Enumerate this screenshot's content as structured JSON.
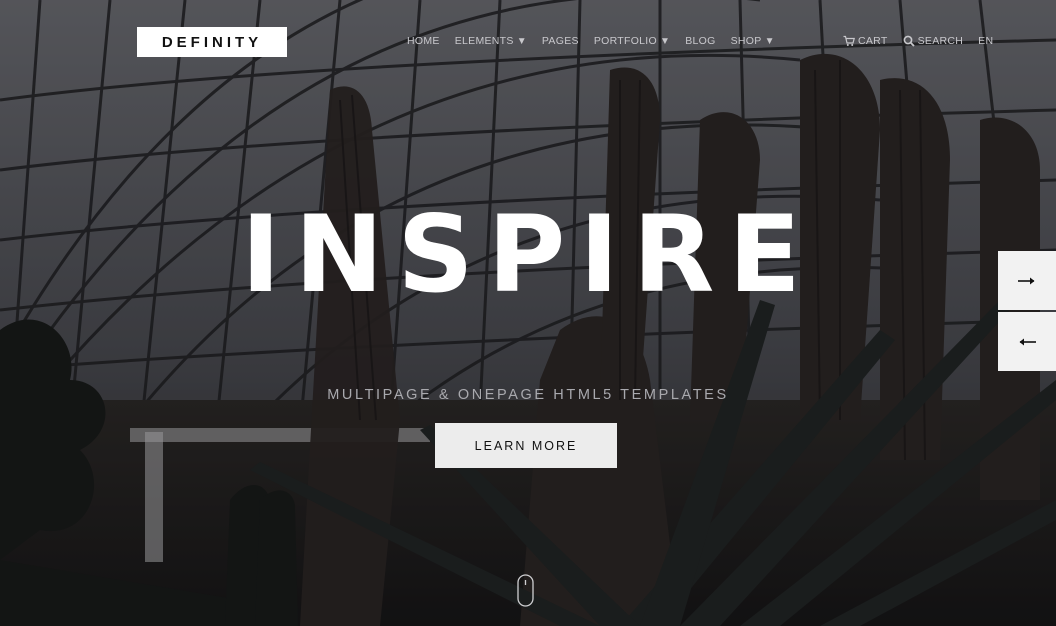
{
  "header": {
    "logo": "DEFINITY",
    "nav": [
      {
        "label": "HOME",
        "has_dropdown": false
      },
      {
        "label": "ELEMENTS",
        "has_dropdown": true
      },
      {
        "label": "PAGES",
        "has_dropdown": false
      },
      {
        "label": "PORTFOLIO",
        "has_dropdown": true
      },
      {
        "label": "BLOG",
        "has_dropdown": false
      },
      {
        "label": "SHOP",
        "has_dropdown": true
      }
    ],
    "cart_label": "CART",
    "search_label": "SEARCH",
    "language": "EN",
    "dropdown_caret": "▼"
  },
  "hero": {
    "headline": "INSPIRE",
    "subheadline": "MULTIPAGE & ONEPAGE HTML5 TEMPLATES",
    "cta_label": "LEARN MORE"
  },
  "slider": {
    "next_icon": "arrow-right-icon",
    "prev_icon": "arrow-left-icon"
  },
  "scroll_indicator_icon": "mouse-icon",
  "colors": {
    "nav_text": "#c8c8cc",
    "headline": "#ffffff",
    "button_bg": "#ececec",
    "arrow_bg": "#f2f2f2"
  }
}
